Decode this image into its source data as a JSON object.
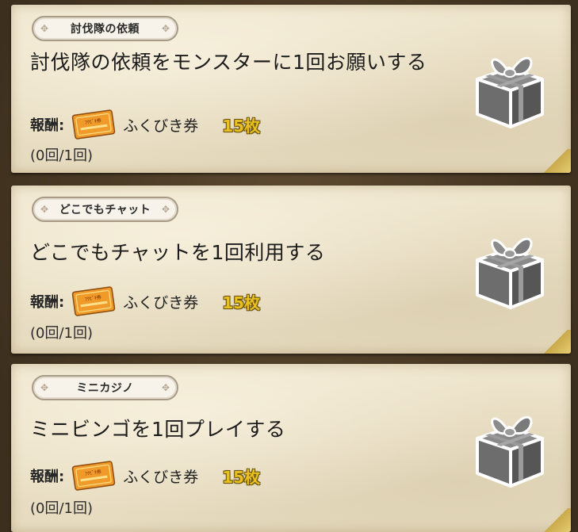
{
  "quests": [
    {
      "category": "討伐隊の依頼",
      "title": "討伐隊の依頼をモンスターに1回お願いする",
      "reward_label": "報酬:",
      "reward_item": "ふくびき券",
      "reward_qty": "15枚",
      "progress": "(0回/1回)",
      "ticket_text": "ﾌｸﾋﾞｷ券",
      "gift_icon": "gray-gift-box-icon"
    },
    {
      "category": "どこでもチャット",
      "title": "どこでもチャットを1回利用する",
      "reward_label": "報酬:",
      "reward_item": "ふくびき券",
      "reward_qty": "15枚",
      "progress": "(0回/1回)",
      "ticket_text": "ﾌｸﾋﾞｷ券",
      "gift_icon": "gray-gift-box-icon"
    },
    {
      "category": "ミニカジノ",
      "title": "ミニビンゴを1回プレイする",
      "reward_label": "報酬:",
      "reward_item": "ふくびき券",
      "reward_qty": "15枚",
      "progress": "(0回/1回)",
      "ticket_text": "ﾌｸﾋﾞｷ券",
      "gift_icon": "gray-gift-box-icon"
    }
  ],
  "colors": {
    "parchment": "#ece2c9",
    "quantity_gold": "#e8c020",
    "ticket_orange": "#f09a2a",
    "gift_gray": "#707070"
  }
}
